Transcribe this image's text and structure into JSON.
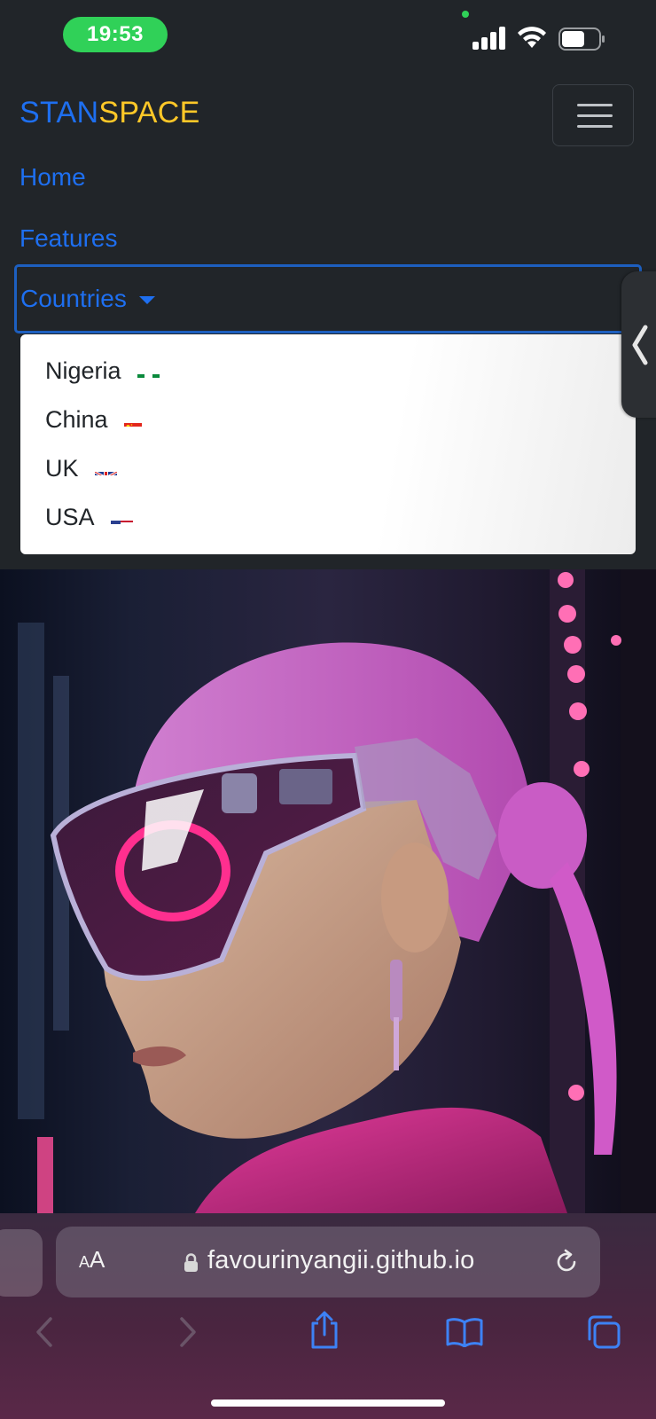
{
  "status_bar": {
    "time": "19:53"
  },
  "navbar": {
    "brand_part1": "STAN",
    "brand_part2": "SPACE",
    "brand_color1": "#1e6ff0",
    "brand_color2": "#ffc828",
    "links": [
      {
        "label": "Home"
      },
      {
        "label": "Features"
      }
    ],
    "dropdown": {
      "label": "Countries",
      "items": [
        {
          "label": "Nigeria",
          "flag": "nigeria-flag-icon"
        },
        {
          "label": "China",
          "flag": "china-flag-icon"
        },
        {
          "label": "UK",
          "flag": "uk-flag-icon"
        },
        {
          "label": "USA",
          "flag": "usa-flag-icon"
        }
      ]
    }
  },
  "hero": {
    "image": "futuristic-woman-pink-hair-visor"
  },
  "browser": {
    "text_size_label_small": "A",
    "text_size_label_large": "A",
    "url": "favourinyangii.github.io"
  }
}
